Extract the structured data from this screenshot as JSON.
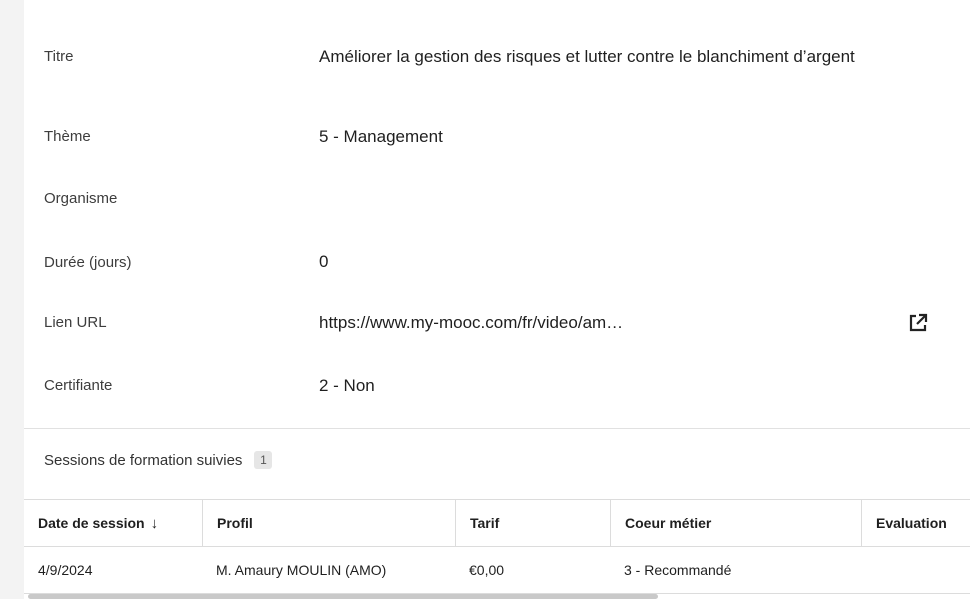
{
  "fields": [
    {
      "label": "Titre",
      "value": "Améliorer la gestion des risques et lutter contre le blanchiment d’argent"
    },
    {
      "label": "Thème",
      "value": "5 - Management"
    },
    {
      "label": "Organisme",
      "value": ""
    },
    {
      "label": "Durée (jours)",
      "value": "0"
    },
    {
      "label": "Lien URL",
      "value": "https://www.my-mooc.com/fr/video/am…"
    },
    {
      "label": "Certifiante",
      "value": "2 - Non"
    }
  ],
  "sessions": {
    "title": "Sessions de formation suivies",
    "count": "1",
    "columns": [
      "Date de session",
      "Profil",
      "Tarif",
      "Coeur métier",
      "Evaluation"
    ],
    "sort_indicator": "↓",
    "rows": [
      [
        "4/9/2024",
        "M. Amaury MOULIN (AMO)",
        "€0,00",
        "3 - Recommandé",
        ""
      ]
    ]
  },
  "icons": {
    "external_link": "external-link-icon"
  }
}
